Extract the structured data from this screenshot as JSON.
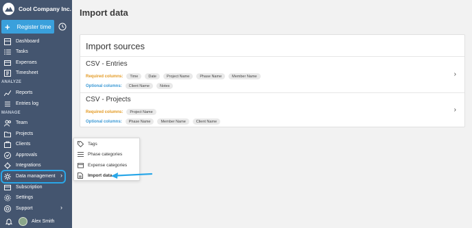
{
  "brand": {
    "name": "Cool Company Inc."
  },
  "actions": {
    "register_label": "Register time"
  },
  "sidebar": {
    "items_top": [
      {
        "label": "Dashboard",
        "icon": "dashboard-icon"
      },
      {
        "label": "Tasks",
        "icon": "tasks-icon"
      },
      {
        "label": "Expenses",
        "icon": "expenses-icon"
      },
      {
        "label": "Timesheet",
        "icon": "timesheet-icon"
      }
    ],
    "section_analyze": "ANALYZE",
    "items_analyze": [
      {
        "label": "Reports",
        "icon": "reports-icon"
      },
      {
        "label": "Entries log",
        "icon": "entries-log-icon"
      }
    ],
    "section_manage": "MANAGE",
    "items_manage": [
      {
        "label": "Team",
        "icon": "team-icon"
      },
      {
        "label": "Projects",
        "icon": "projects-icon"
      },
      {
        "label": "Clients",
        "icon": "clients-icon"
      },
      {
        "label": "Approvals",
        "icon": "approvals-icon"
      },
      {
        "label": "Integrations",
        "icon": "integrations-icon"
      },
      {
        "label": "Data management",
        "icon": "data-management-icon"
      },
      {
        "label": "Subscription",
        "icon": "subscription-icon"
      },
      {
        "label": "Settings",
        "icon": "settings-icon"
      },
      {
        "label": "Support",
        "icon": "support-icon"
      }
    ],
    "user_name": "Alex Smith"
  },
  "page": {
    "title": "Import data",
    "panel_title": "Import sources",
    "sources": [
      {
        "title": "CSV - Entries",
        "required_label": "Required columns:",
        "required": [
          "Time",
          "Date",
          "Project Name",
          "Phase Name",
          "Member Name"
        ],
        "optional_label": "Optional columns:",
        "optional": [
          "Client Name",
          "Notes"
        ]
      },
      {
        "title": "CSV - Projects",
        "required_label": "Required columns:",
        "required": [
          "Project Name"
        ],
        "optional_label": "Optional columns:",
        "optional": [
          "Phase Name",
          "Member Name",
          "Client Name"
        ]
      }
    ]
  },
  "dropdown": {
    "items": [
      {
        "label": "Tags",
        "icon": "tag-icon"
      },
      {
        "label": "Phase categories",
        "icon": "list-icon"
      },
      {
        "label": "Expense categories",
        "icon": "folder-icon"
      },
      {
        "label": "Import data",
        "icon": "file-icon"
      }
    ]
  },
  "colors": {
    "sidebar": "#44556f",
    "accent": "#3aa0dc",
    "required": "#e39a23",
    "optional": "#3a98d4",
    "highlight": "#2aa7e8"
  }
}
